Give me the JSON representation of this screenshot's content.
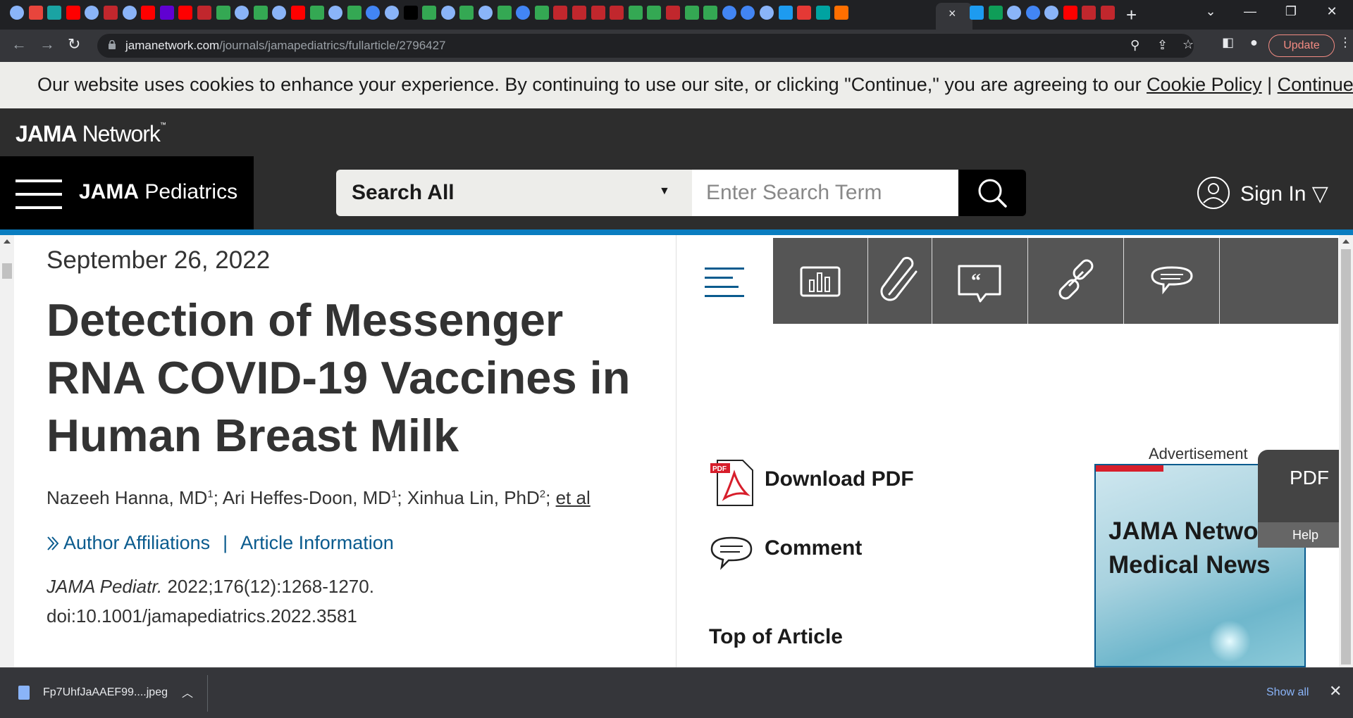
{
  "browser": {
    "active_tab_close": "×",
    "new_tab": "+",
    "url_host": "jamanetwork.com",
    "url_path": "/journals/jamapediatrics/fullarticle/2796427",
    "update_label": "Update",
    "tab_favicons": [
      "globe-icon",
      "brand-icon",
      "stat-icon",
      "youtube-icon",
      "globe-icon",
      "bi-icon",
      "globe-icon",
      "youtube-icon",
      "yahoo-icon",
      "youtube-icon",
      "bi-icon",
      "play-icon",
      "globe-icon",
      "play-icon",
      "globe-icon",
      "youtube-icon",
      "play-icon",
      "globe-icon",
      "play-icon",
      "search-icon",
      "globe-icon",
      "n-icon",
      "play-icon",
      "globe-icon",
      "play-icon",
      "globe-icon",
      "play-icon",
      "search-icon",
      "play-icon",
      "bi-icon",
      "bi-icon",
      "bi-icon",
      "bi-icon",
      "play-icon",
      "play-icon",
      "bi-icon",
      "play-icon",
      "play-icon",
      "search-icon",
      "search-icon",
      "globe-icon",
      "twitter-icon",
      "red-icon",
      "pj-icon",
      "bookmark-icon"
    ],
    "tabs_right": [
      "twitter-icon",
      "g-icon",
      "globe-icon",
      "search-icon",
      "globe-icon",
      "youtube-icon",
      "bi-icon",
      "bi-icon"
    ]
  },
  "cookie_banner": {
    "text": "Our website uses cookies to enhance your experience. By continuing to use our site, or clicking \"Continue,\" you are agreeing to our ",
    "policy_link": "Cookie Policy",
    "separator": " | ",
    "continue_link": "Continue"
  },
  "site_header": {
    "logo_bold": "JAMA",
    "logo_rest": " Network",
    "logo_tm": "™",
    "journal_bold": "JAMA",
    "journal_rest": " Pediatrics",
    "search_scope": "Search All",
    "search_caret": "▼",
    "search_placeholder": "Enter Search Term",
    "sign_in": "Sign In",
    "sign_in_caret": "▽"
  },
  "article": {
    "date": "September 26, 2022",
    "title": "Detection of Messenger RNA COVID-19 Vaccines in Human Breast Milk",
    "authors": [
      {
        "name": "Nazeeh Hanna, MD",
        "sup": "1"
      },
      {
        "name": "Ari Heffes-Doon, MD",
        "sup": "1"
      },
      {
        "name": "Xinhua Lin, PhD",
        "sup": "2"
      }
    ],
    "author_sep": "; ",
    "et_al": "et al",
    "affiliations_link": "Author Affiliations",
    "affil_separator": "|",
    "article_info_link": "Article Information",
    "journal_abbrev": "JAMA Pediatr.",
    "citation": " 2022;176(12):1268-1270.",
    "doi": "doi:10.1001/jamapediatrics.2022.3581"
  },
  "sidebar": {
    "tools": [
      "figures-icon",
      "attachment-icon",
      "cite-icon",
      "link-icon",
      "comment-icon"
    ],
    "download_pdf": "Download PDF",
    "comment": "Comment",
    "top_of_article": "Top of Article",
    "advertisement_label": "Advertisement",
    "advert_text_line1": "JAMA Network",
    "advert_text_line2": "Medical News",
    "pdf_float": "PDF",
    "help_float": "Help"
  },
  "download_shelf": {
    "file_name": "Fp7UhfJaAAEF99....jpeg",
    "show_all": "Show all"
  },
  "colors": {
    "brand_blue": "#0a7dc0",
    "link_blue": "#0a5b8e",
    "header_dark": "#2d2d2d",
    "ad_red": "#d71e2b"
  }
}
